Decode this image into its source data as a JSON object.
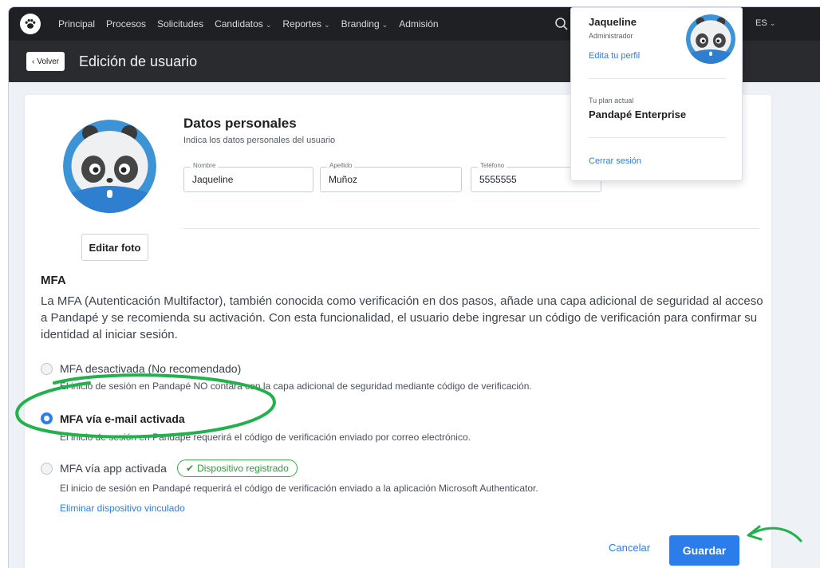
{
  "nav": {
    "items": [
      {
        "label": "Principal",
        "dropdown": false
      },
      {
        "label": "Procesos",
        "dropdown": false
      },
      {
        "label": "Solicitudes",
        "dropdown": false
      },
      {
        "label": "Candidatos",
        "dropdown": true
      },
      {
        "label": "Reportes",
        "dropdown": true
      },
      {
        "label": "Branding",
        "dropdown": true
      },
      {
        "label": "Admisión",
        "dropdown": false
      }
    ],
    "lang": "ES",
    "chevron": "⌄"
  },
  "subheader": {
    "back_label": "Volver",
    "title": "Edición de usuario"
  },
  "personal": {
    "title": "Datos personales",
    "subtitle": "Indica los datos personales del usuario",
    "edit_photo": "Editar foto",
    "fields": [
      {
        "label": "Nombre",
        "value": "Jaqueline"
      },
      {
        "label": "Apellido",
        "value": "Muñoz"
      },
      {
        "label": "Teléfono",
        "value": "5555555"
      }
    ]
  },
  "mfa": {
    "title": "MFA",
    "description": "La MFA (Autenticación Multifactor), también conocida como verificación en dos pasos, añade una capa adicional de seguridad al acceso a Pandapé y se recomienda su activación. Con esta funcionalidad, el usuario debe ingresar un código de verificación para confirmar su identidad al iniciar sesión.",
    "options": [
      {
        "label": "MFA desactivada (No recomendado)",
        "sub": "El inicio de sesión en Pandapé NO contará con la capa adicional de seguridad mediante código de verificación.",
        "selected": false
      },
      {
        "label": "MFA vía e-mail activada",
        "sub": "El inicio de sesión en Pandapé requerirá el código de verificación enviado por correo electrónico.",
        "selected": true
      },
      {
        "label": "MFA vía app activada",
        "sub": "El inicio de sesión en Pandapé requerirá el código de verificación enviado a la aplicación Microsoft Authenticator.",
        "selected": false
      }
    ],
    "badge": "Dispositivo registrado",
    "remove_link": "Eliminar dispositivo vinculado"
  },
  "actions": {
    "cancel": "Cancelar",
    "save": "Guardar"
  },
  "profile_menu": {
    "name": "Jaqueline",
    "role": "Administrador",
    "edit_profile": "Edita tu perfil",
    "plan_label": "Tu plan actual",
    "plan": "Pandapé Enterprise",
    "logout": "Cerrar sesión"
  },
  "colors": {
    "accent": "#2b7de9",
    "nav_bg": "#1f2023",
    "badge_green": "#3ba84a",
    "annotation_green": "#22b14c"
  },
  "icons": [
    "paw-icon",
    "search-icon",
    "back-chevron-icon",
    "panda-avatar-icon",
    "check-icon"
  ]
}
